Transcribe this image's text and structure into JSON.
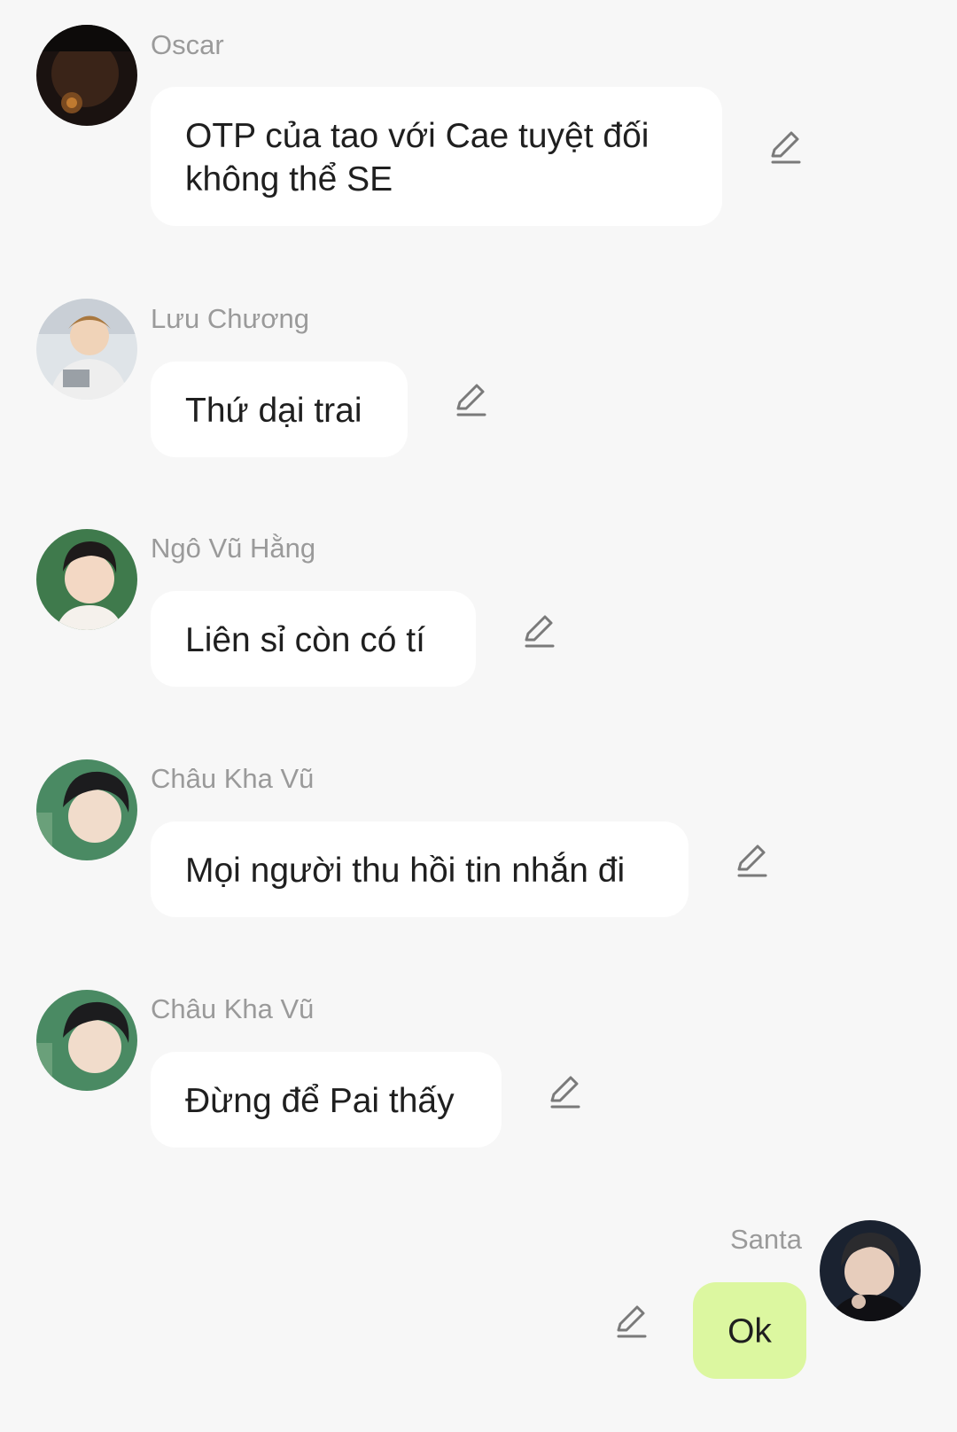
{
  "messages": [
    {
      "sender": "Oscar",
      "text": "OTP của tao với Cae tuyệt đối không thể SE",
      "avatar": "avatar-dark-photo"
    },
    {
      "sender": "Lưu Chương",
      "text": "Thứ dại trai",
      "avatar": "avatar-light-photo"
    },
    {
      "sender": "Ngô Vũ Hằng",
      "text": "Liên sỉ còn có tí",
      "avatar": "avatar-green-photo"
    },
    {
      "sender": "Châu Kha Vũ",
      "text": "Mọi người thu hồi tin nhắn đi",
      "avatar": "avatar-green-portrait"
    },
    {
      "sender": "Châu Kha Vũ",
      "text": "Đừng để Pai thấy",
      "avatar": "avatar-green-portrait"
    },
    {
      "sender": "Santa",
      "text": "Ok",
      "avatar": "avatar-dark-portrait",
      "own": true
    }
  ],
  "icons": {
    "edit": "pencil-edit-icon"
  },
  "colors": {
    "background": "#f7f7f7",
    "bubble": "#ffffff",
    "own_bubble": "#dcf7a0",
    "sender_name": "#9a9a9a",
    "icon": "#7a7a7a"
  }
}
